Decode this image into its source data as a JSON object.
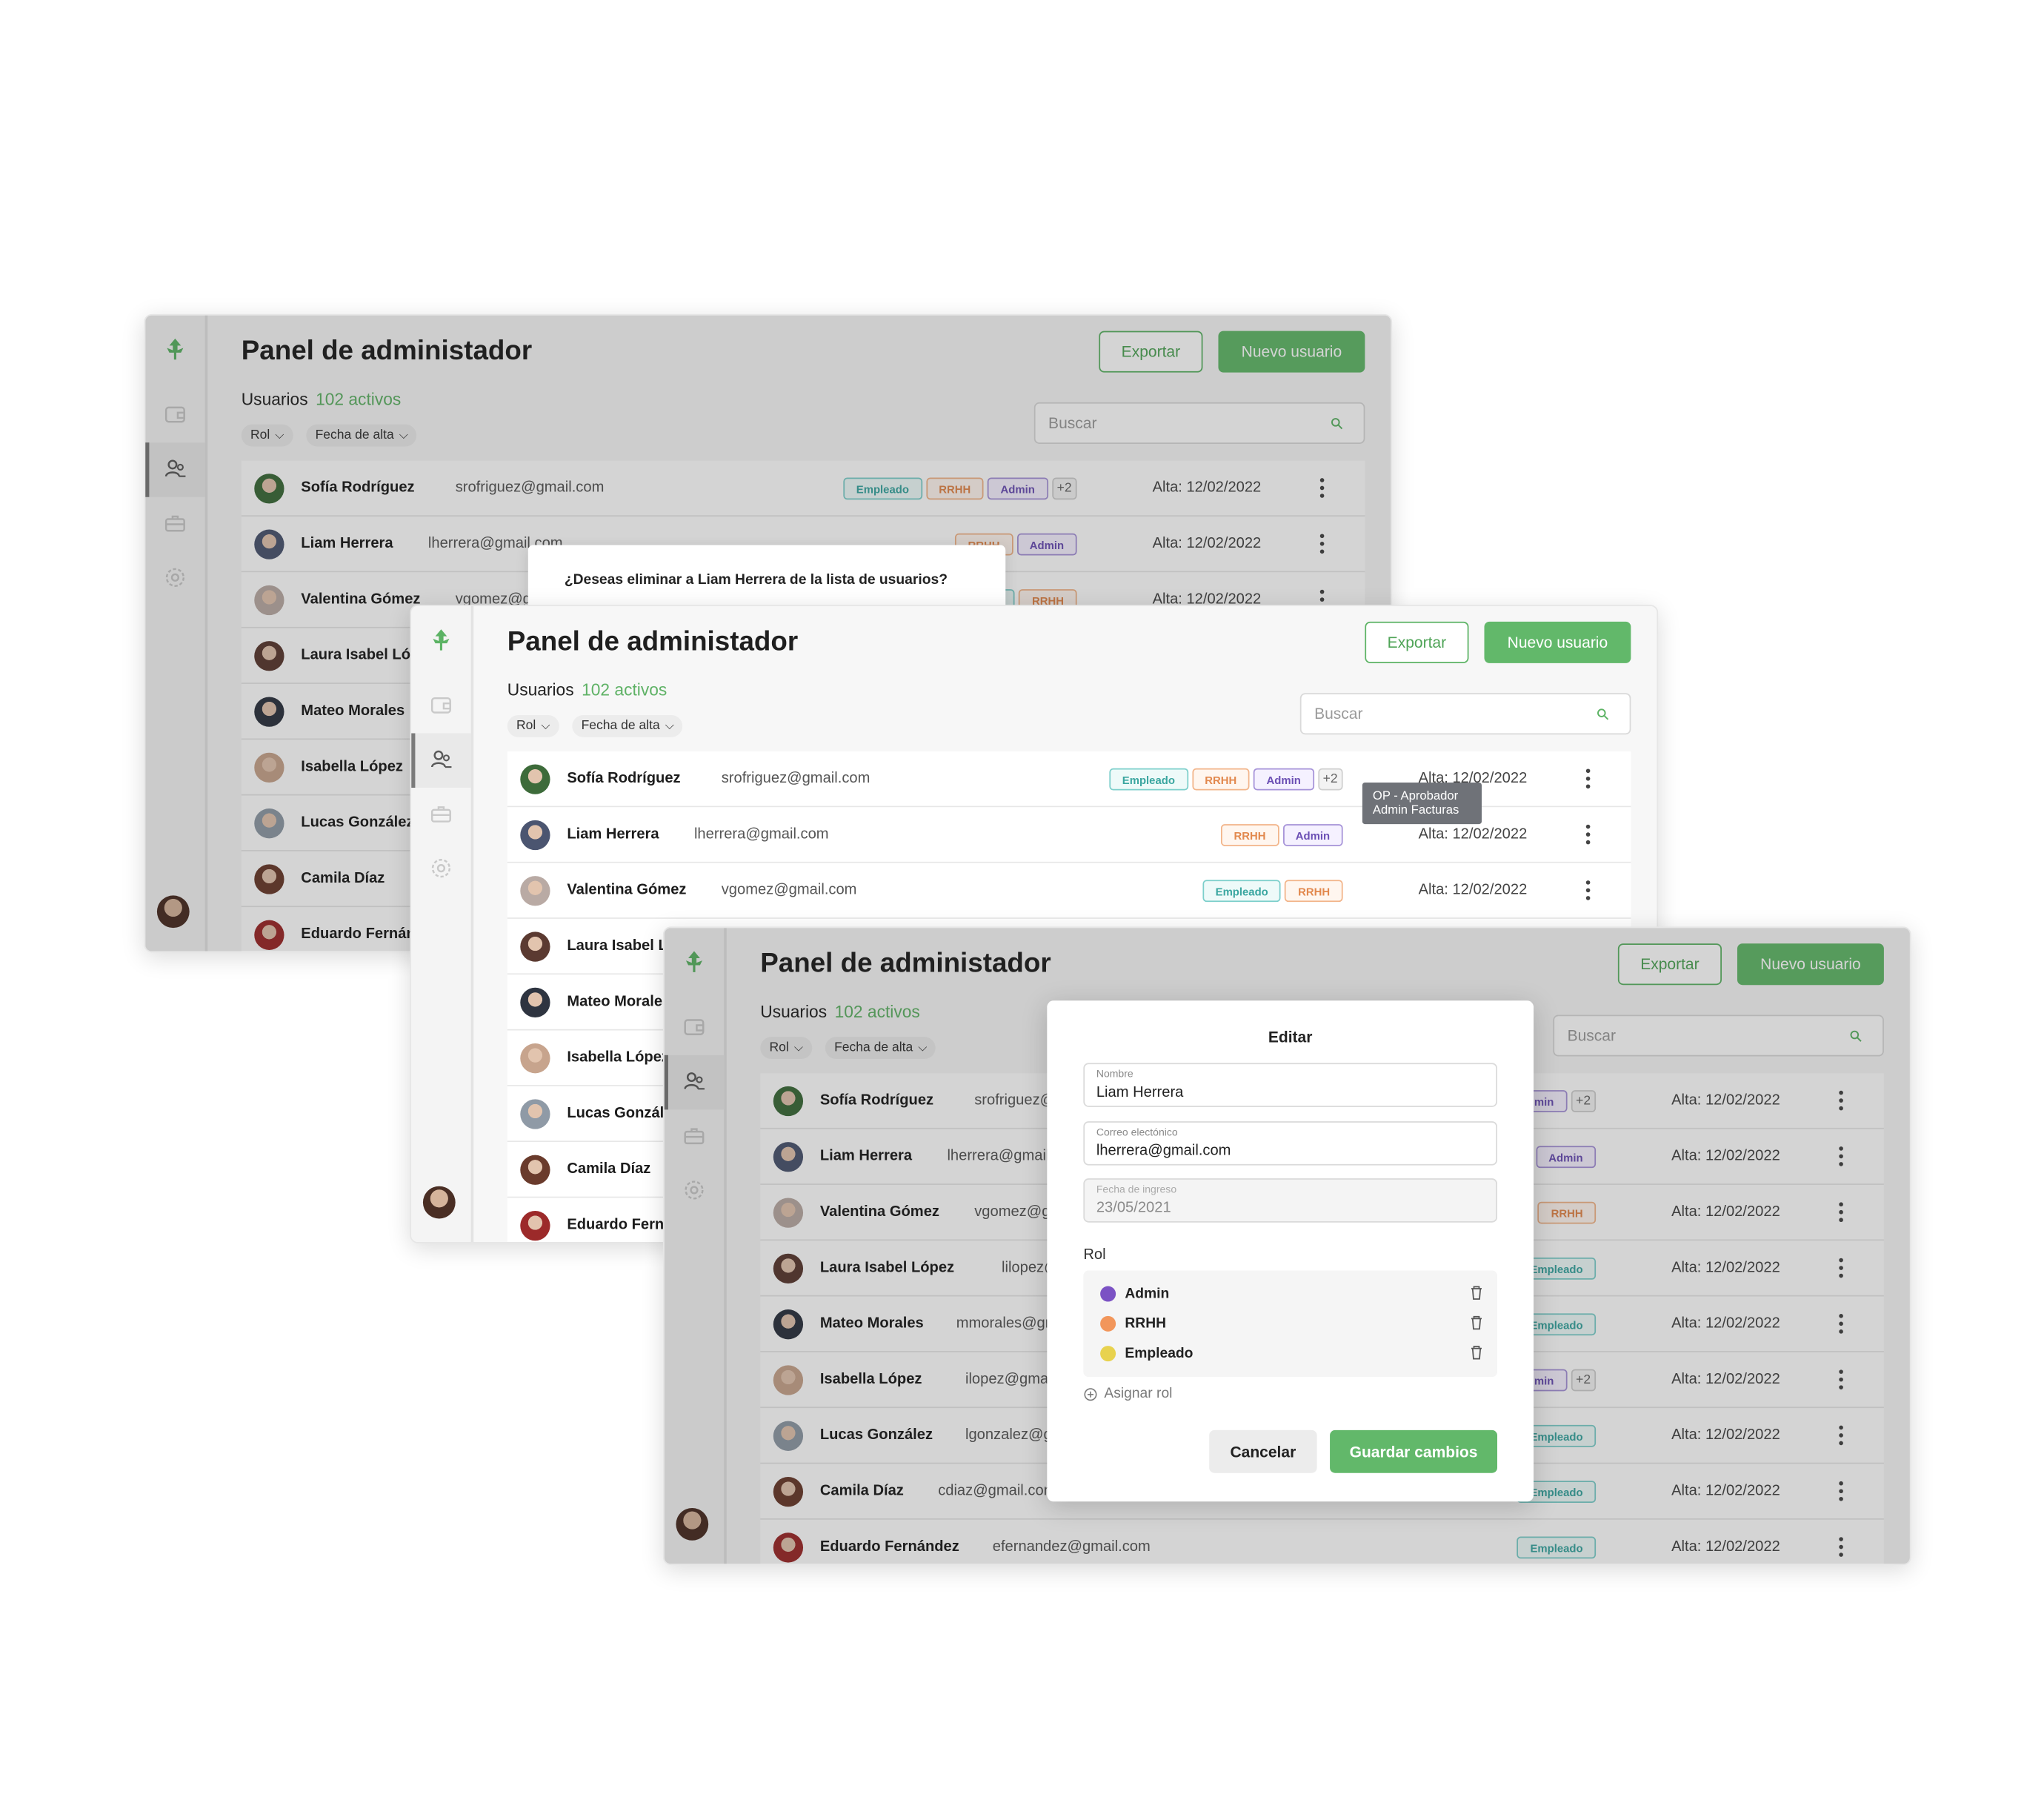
{
  "app": {
    "title": "Panel de administador",
    "export_label": "Exportar",
    "new_user_label": "Nuevo usuario",
    "users_label": "Usuarios",
    "active_count": "102 activos",
    "filters": [
      "Rol",
      "Fecha de alta"
    ],
    "search_placeholder": "Buscar"
  },
  "users": [
    {
      "name": "Sofía Rodríguez",
      "email": "srofriguez@gmail.com",
      "roles": [
        "Empleado",
        "RRHH",
        "Admin"
      ],
      "extra": "+2",
      "alta": "Alta: 12/02/2022",
      "avatar_color": "#3d6b3a"
    },
    {
      "name": "Liam Herrera",
      "email": "lherrera@gmail.com",
      "roles": [
        "RRHH",
        "Admin"
      ],
      "extra": "",
      "alta": "Alta: 12/02/2022",
      "avatar_color": "#4b5570"
    },
    {
      "name": "Valentina Gómez",
      "email": "vgomez@gmail.com",
      "roles": [
        "Empleado",
        "RRHH"
      ],
      "extra": "",
      "alta": "Alta: 12/02/2022",
      "avatar_color": "#b9aaa4"
    },
    {
      "name": "Laura Isabel López",
      "email": "lilopez@gmail.com",
      "roles": [
        "Empleado"
      ],
      "extra": "",
      "alta": "Alta: 12/02/2022",
      "avatar_color": "#5b3a31"
    },
    {
      "name": "Mateo Morales",
      "email": "mmorales@gmail.com",
      "roles": [
        "Empleado"
      ],
      "extra": "",
      "alta": "Alta: 12/02/2022",
      "avatar_color": "#2e3440"
    },
    {
      "name": "Isabella López",
      "email": "ilopez@gmail.com",
      "roles": [
        "Admin"
      ],
      "extra": "+2",
      "alta": "Alta: 12/02/2022",
      "avatar_color": "#c7a48d"
    },
    {
      "name": "Lucas González",
      "email": "lgonzalez@gmail.com",
      "roles": [
        "Empleado"
      ],
      "extra": "",
      "alta": "Alta: 12/02/2022",
      "avatar_color": "#8f9aa6"
    },
    {
      "name": "Camila Díaz",
      "email": "cdiaz@gmail.com",
      "roles": [
        "Empleado"
      ],
      "extra": "",
      "alta": "Alta: 12/02/2022",
      "avatar_color": "#6a3b2c"
    },
    {
      "name": "Eduardo Fernández",
      "email": "efernandez@gmail.com",
      "roles": [
        "Empleado"
      ],
      "extra": "",
      "alta": "Alta: 12/02/2022",
      "avatar_color": "#9c2a2a"
    }
  ],
  "confirm_dialog": {
    "question": "¿Deseas eliminar a Liam Herrera de la lista de usuarios?"
  },
  "tooltip": {
    "line1": "OP - Aprobador",
    "line2": "Admin Facturas"
  },
  "edit_modal": {
    "title": "Editar",
    "name_label": "Nombre",
    "name_value": "Liam Herrera",
    "email_label": "Correo electónico",
    "email_value": "lherrera@gmail.com",
    "date_label": "Fecha de ingreso",
    "date_value": "23/05/2021",
    "rol_label": "Rol",
    "roles": [
      {
        "name": "Admin",
        "color": "#7b52c4"
      },
      {
        "name": "RRHH",
        "color": "#f2965b"
      },
      {
        "name": "Empleado",
        "color": "#e8d24e"
      }
    ],
    "assign_label": "Asignar rol",
    "cancel_label": "Cancelar",
    "save_label": "Guardar cambios"
  },
  "colors": {
    "accent": "#62b86a",
    "empleado": "#3aa6a0",
    "rrhh": "#e2884d",
    "admin": "#6b4fb4"
  },
  "icons": [
    "logo-icon",
    "wallet-icon",
    "users-icon",
    "briefcase-icon",
    "settings-icon",
    "search-icon",
    "kebab-icon",
    "trash-icon",
    "add-circle-icon"
  ]
}
